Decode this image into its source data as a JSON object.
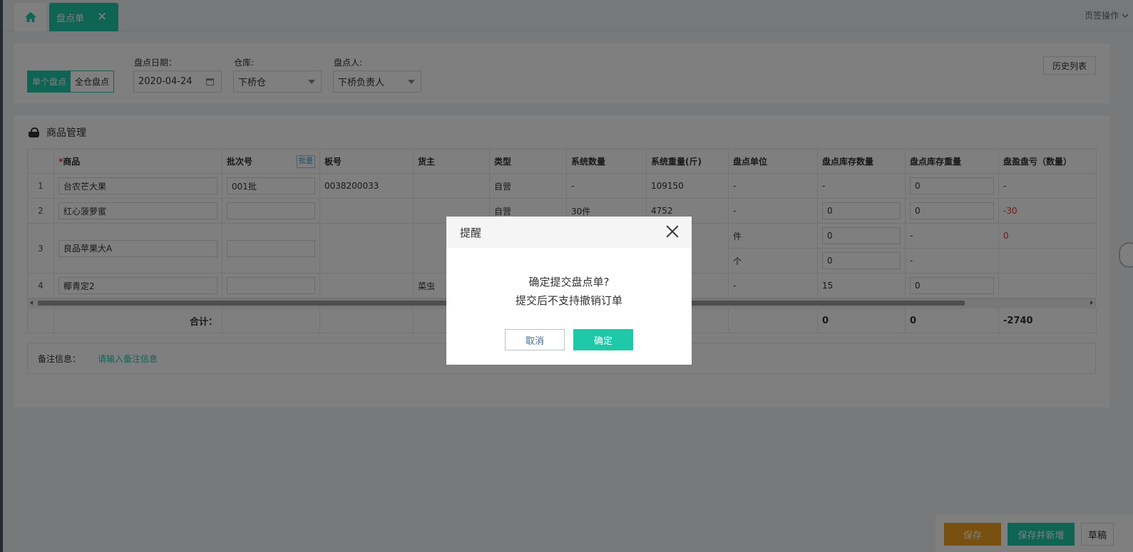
{
  "tabs": {
    "home_icon": "home-icon",
    "active_label": "盘点单",
    "close_symbol": "✕",
    "page_ops_label": "页签操作"
  },
  "filter": {
    "mode_single": "单个盘点",
    "mode_all": "全仓盘点",
    "date_label": "盘点日期：",
    "date_value": "2020-04-24",
    "warehouse_label": "仓库:",
    "warehouse_value": "下桥仓",
    "person_label": "盘点人:",
    "person_value": "下桥负责人",
    "history_button": "历史列表"
  },
  "goods": {
    "section_title": "商品管理",
    "required_mark": "*",
    "batch_button": "批量",
    "columns": [
      "",
      "商品",
      "批次号",
      "板号",
      "货主",
      "类型",
      "系统数量",
      "系统重量(斤)",
      "盘点单位",
      "盘点库存数量",
      "盘点库存重量",
      "盘盈盘亏（数量）"
    ],
    "rows": [
      {
        "idx": "1",
        "product": "台农芒大果",
        "batch": "001批",
        "board": "0038200033",
        "owner": "",
        "type": "自营",
        "sys_qty": "-",
        "sys_weight": "109150",
        "unit": "-",
        "count_qty": "-",
        "count_weight": "0",
        "diff": "-"
      },
      {
        "idx": "2",
        "product": "红心菠萝蜜",
        "batch": "",
        "board": "",
        "owner": "",
        "type": "自营",
        "sys_qty": "30件",
        "sys_weight": "4752",
        "unit": "-",
        "count_qty": "0",
        "count_weight": "0",
        "diff": "-30"
      },
      {
        "idx": "3",
        "product": "良品苹果大A",
        "batch": "",
        "board": "",
        "owner": "",
        "type": "",
        "sys_qty": "",
        "sys_weight": "",
        "unit": "件",
        "count_qty": "0",
        "count_weight": "-",
        "diff": "0",
        "unit2": "个",
        "count_qty2": "0",
        "count_weight2": "-",
        "diff2": ""
      },
      {
        "idx": "4",
        "product": "椰青定2",
        "batch": "",
        "board": "",
        "owner": "菜虫",
        "type": "",
        "sys_qty": "",
        "sys_weight": "",
        "unit": "-",
        "count_qty": "15",
        "count_weight": "0",
        "diff": ""
      }
    ],
    "total_label": "合计：",
    "total_count_qty": "0",
    "total_count_weight": "0",
    "total_diff": "-2740",
    "remark_label": "备注信息：",
    "remark_placeholder": "请输入备注信息"
  },
  "footer": {
    "save": "保存",
    "save_new": "保存并新增",
    "draft": "草稿"
  },
  "dialog": {
    "title": "提醒",
    "line1": "确定提交盘点单?",
    "line2": "提交后不支持撤销订单",
    "cancel": "取消",
    "ok": "确定"
  },
  "colors": {
    "accent": "#1fc8a8",
    "danger": "#e33333",
    "save": "#f0a020"
  }
}
